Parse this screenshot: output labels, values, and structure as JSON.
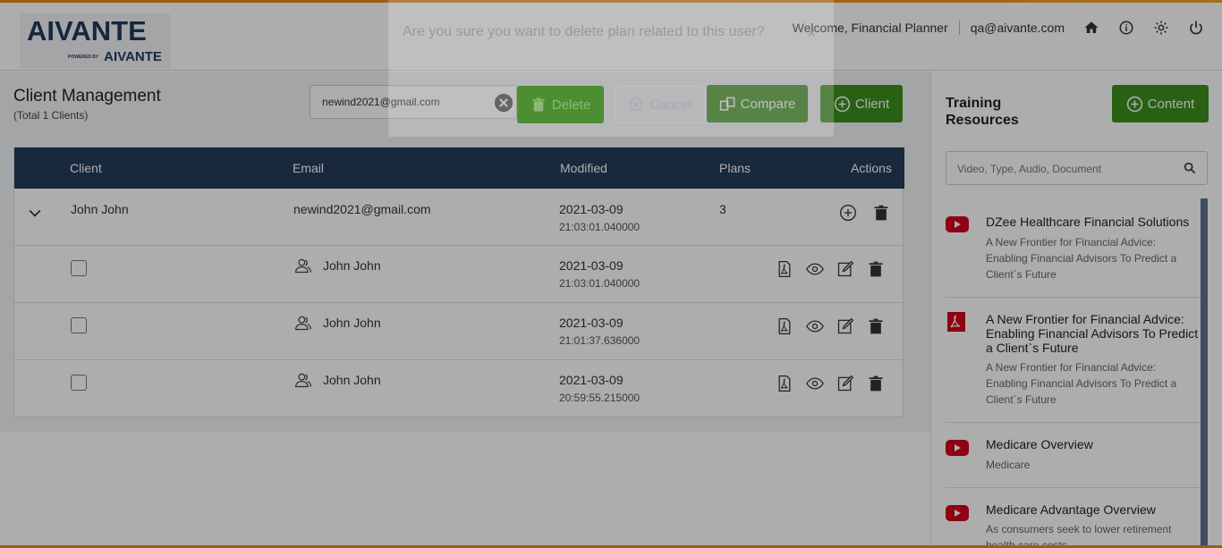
{
  "header": {
    "logo_main": "AIVANTE",
    "logo_powered": "POWERED BY",
    "logo_sub": "AIVANTE",
    "welcome": "Welcome, Financial Planner",
    "email": "qa@aivante.com",
    "icons": [
      "home-icon",
      "info-icon",
      "gear-icon",
      "power-icon"
    ]
  },
  "main": {
    "title": "Client Management",
    "subtitle": "(Total 1 Clients)",
    "search_value": "newind2021@gmail.com",
    "compare_label": "Compare",
    "client_label": "Client",
    "columns": [
      "Client",
      "Email",
      "Modified",
      "Plans",
      "Actions"
    ],
    "client_row": {
      "name": "John John",
      "email": "newind2021@gmail.com",
      "date": "2021-03-09",
      "time": "21:03:01.040000",
      "plans": "3"
    },
    "plans": [
      {
        "name": "John John",
        "date": "2021-03-09",
        "time": "21:03:01.040000"
      },
      {
        "name": "John John",
        "date": "2021-03-09",
        "time": "21:01:37.636000"
      },
      {
        "name": "John John",
        "date": "2021-03-09",
        "time": "20:59:55.215000"
      }
    ]
  },
  "training": {
    "title": "Training Resources",
    "content_label": "Content",
    "search_placeholder": "Video, Type, Audio, Document",
    "items": [
      {
        "icon": "youtube-icon",
        "title": "DZee Healthcare Financial Solutions",
        "desc": "A New Frontier for Financial Advice: Enabling Financial Advisors To Predict a Client`s Future"
      },
      {
        "icon": "pdf-icon",
        "title": "A New Frontier for Financial Advice: Enabling Financial Advisors To Predict a Client`s Future",
        "desc": "A New Frontier for Financial Advice: Enabling Financial Advisors To Predict a Client`s Future"
      },
      {
        "icon": "youtube-icon",
        "title": "Medicare Overview",
        "desc": "Medicare"
      },
      {
        "icon": "youtube-icon",
        "title": "Medicare Advantage Overview",
        "desc": "As consumers seek to lower retirement health care costs..."
      }
    ]
  },
  "dialog": {
    "question": "Are you sure you want to delete plan related to this user?",
    "close": "×",
    "delete_label": "Delete",
    "cancel_label": "Cancel"
  },
  "colors": {
    "navy": "#243b5a",
    "green": "#3c8f1e",
    "orange": "#e8891d",
    "youtube": "#d0021b"
  }
}
